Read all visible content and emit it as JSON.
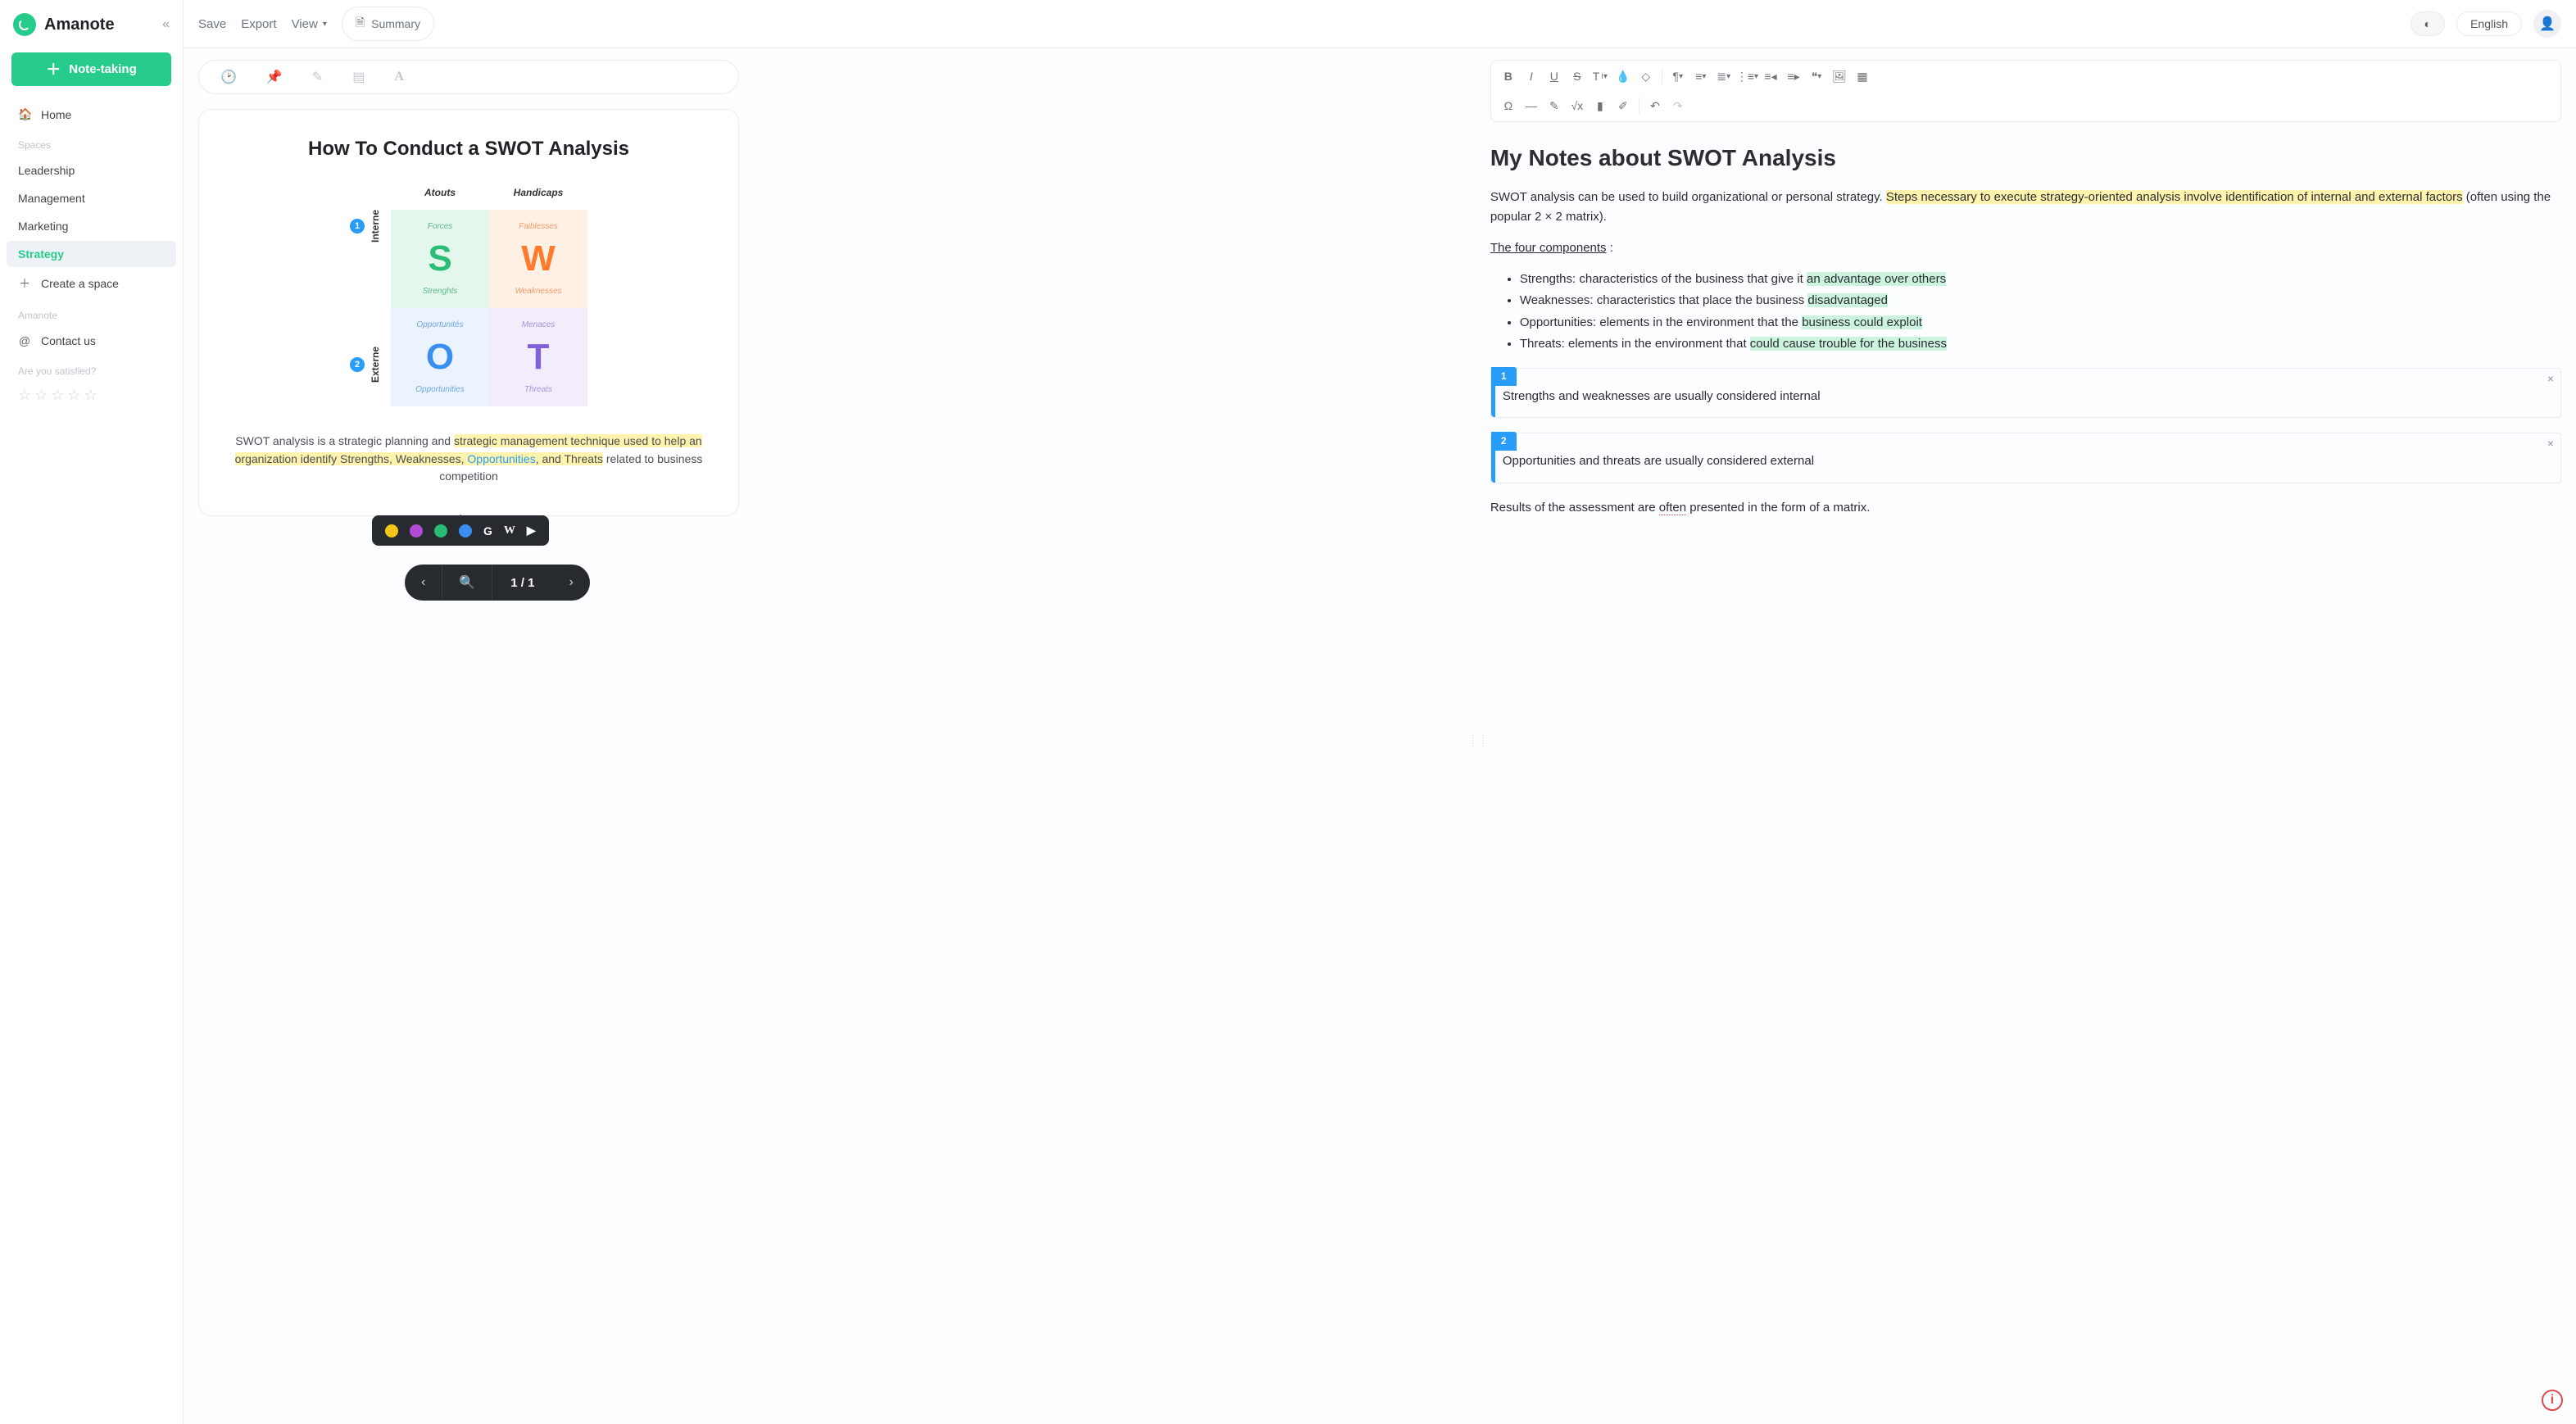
{
  "brand": {
    "name": "Amanote"
  },
  "sidebar": {
    "cta": "Note-taking",
    "home": "Home",
    "spaces_label": "Spaces",
    "spaces": [
      "Leadership",
      "Management",
      "Marketing",
      "Strategy"
    ],
    "active_space_index": 3,
    "create_space": "Create a space",
    "app_label": "Amanote",
    "contact": "Contact us",
    "rating_label": "Are you satisfied?"
  },
  "topbar": {
    "save": "Save",
    "export": "Export",
    "view": "View",
    "summary": "Summary",
    "language": "English"
  },
  "doc": {
    "title": "How To Conduct a SWOT Analysis",
    "col_left": "Atouts",
    "col_right": "Handicaps",
    "row1": {
      "num": "1",
      "label": "Interne"
    },
    "row2": {
      "num": "2",
      "label": "Externe"
    },
    "q": {
      "s": {
        "top": "Forces",
        "big": "S",
        "bot": "Strenghts"
      },
      "w": {
        "top": "Faiblesses",
        "big": "W",
        "bot": "Weaknesses"
      },
      "o": {
        "top": "Opportunités",
        "big": "O",
        "bot": "Opportunities"
      },
      "t": {
        "top": "Menaces",
        "big": "T",
        "bot": "Threats"
      }
    },
    "caption": {
      "pre": "SWOT analysis is a strategic planning and ",
      "hl1": "strategic management technique used to help an organization identify Strengths, Weaknesses, ",
      "link": "Opportunities",
      "hl2": ", and Threats",
      "post": " related to business competition"
    },
    "page": "1 / 1",
    "popup": {
      "colors": [
        "#f5c518",
        "#b24bd6",
        "#2bbd76",
        "#3a8ef0"
      ],
      "ext": [
        "G",
        "W",
        "▶"
      ]
    }
  },
  "notes": {
    "title": "My Notes about SWOT Analysis",
    "p1": {
      "pre": "SWOT analysis can be used to build organizational or personal strategy. ",
      "hl": "Steps necessary to execute strategy-oriented analysis involve identification of internal and external factors",
      "post": " (often using the popular 2 × 2 matrix)."
    },
    "heading": "The four components",
    "heading_post": " :",
    "bullets": [
      {
        "pre": "Strengths: characteristics of the business that give it ",
        "hl": "an advantage over others"
      },
      {
        "pre": "Weaknesses: characteristics that place the business ",
        "hl": "disadvantaged"
      },
      {
        "pre": "Opportunities: elements in the environment that the ",
        "hl": "business could exploit"
      },
      {
        "pre": "Threats: elements in the environment that ",
        "hl": "could cause trouble for the business"
      }
    ],
    "ref1": {
      "num": "1",
      "text": "Strengths and weaknesses are usually considered internal"
    },
    "ref2": {
      "num": "2",
      "text": "Opportunities and threats are usually considered external"
    },
    "tail": {
      "pre": "Results of the assessment are ",
      "u": "often",
      "post": " presented in the form of a matrix."
    }
  },
  "help": "i"
}
